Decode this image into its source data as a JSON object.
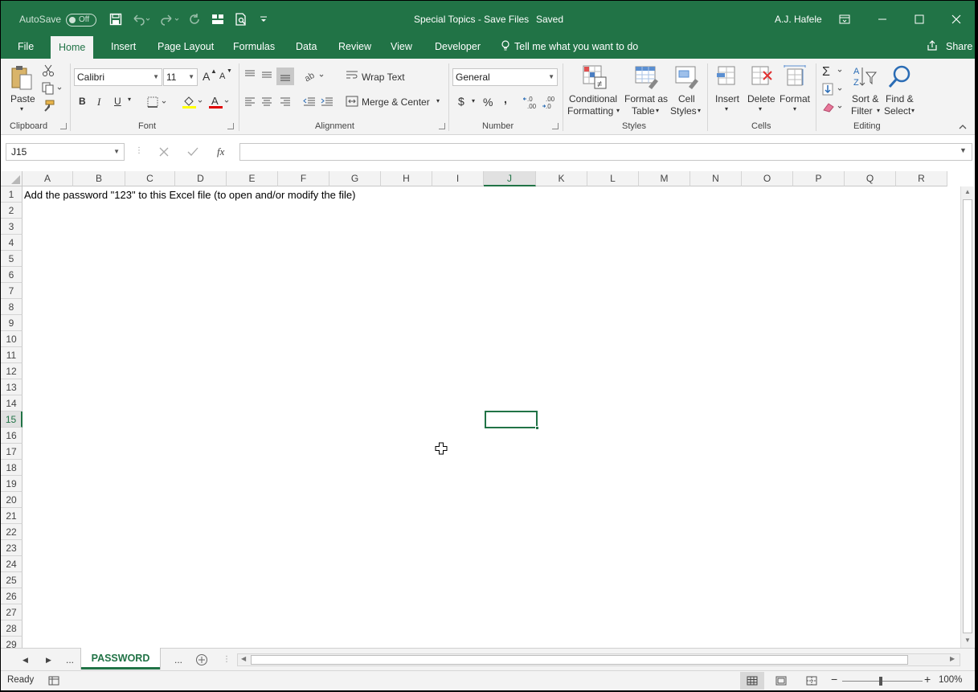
{
  "titlebar": {
    "autosave_label": "AutoSave",
    "autosave_state": "Off",
    "doc_title": "Special Topics - Save Files",
    "save_state": "Saved",
    "user": "A.J. Hafele"
  },
  "tabs": {
    "file": "File",
    "home": "Home",
    "insert": "Insert",
    "page_layout": "Page Layout",
    "formulas": "Formulas",
    "data": "Data",
    "review": "Review",
    "view": "View",
    "developer": "Developer",
    "tell_me": "Tell me what you want to do",
    "share": "Share"
  },
  "ribbon": {
    "clipboard": {
      "label": "Clipboard",
      "paste": "Paste"
    },
    "font": {
      "label": "Font",
      "name": "Calibri",
      "size": "11",
      "bold": "B",
      "italic": "I",
      "underline": "U",
      "grow": "A",
      "shrink": "A"
    },
    "alignment": {
      "label": "Alignment",
      "wrap": "Wrap Text",
      "merge": "Merge & Center"
    },
    "number": {
      "label": "Number",
      "format": "General",
      "currency": "$",
      "percent": "%",
      "comma": ",",
      "inc_dec": "←.0\n.00",
      "dec_dec": ".00\n→.0"
    },
    "styles": {
      "label": "Styles",
      "conditional_1": "Conditional",
      "conditional_2": "Formatting",
      "format_table_1": "Format as",
      "format_table_2": "Table",
      "cell_styles_1": "Cell",
      "cell_styles_2": "Styles"
    },
    "cells": {
      "label": "Cells",
      "insert": "Insert",
      "delete": "Delete",
      "format": "Format"
    },
    "editing": {
      "label": "Editing",
      "sort_1": "Sort &",
      "sort_2": "Filter",
      "find_1": "Find &",
      "find_2": "Select"
    }
  },
  "formula_bar": {
    "name_box": "J15",
    "fx": "fx",
    "content": ""
  },
  "grid": {
    "columns": [
      "A",
      "B",
      "C",
      "D",
      "E",
      "F",
      "G",
      "H",
      "I",
      "J",
      "K",
      "L",
      "M",
      "N",
      "O",
      "P",
      "Q",
      "R"
    ],
    "selected_column": "J",
    "rows": [
      "1",
      "2",
      "3",
      "4",
      "5",
      "6",
      "7",
      "8",
      "9",
      "10",
      "11",
      "12",
      "13",
      "14",
      "15",
      "16",
      "17",
      "18",
      "19",
      "20",
      "21",
      "22",
      "23",
      "24",
      "25",
      "26",
      "27",
      "28",
      "29"
    ],
    "selected_row": "15",
    "cell_a1": "Add the password \"123\" to this Excel file (to open and/or modify the file)"
  },
  "sheets": {
    "active": "PASSWORD",
    "more_left": "...",
    "more_right": "..."
  },
  "status": {
    "ready": "Ready",
    "zoom": "100%"
  },
  "colors": {
    "accent": "#217346",
    "ribbon_bg": "#f3f3f3"
  }
}
